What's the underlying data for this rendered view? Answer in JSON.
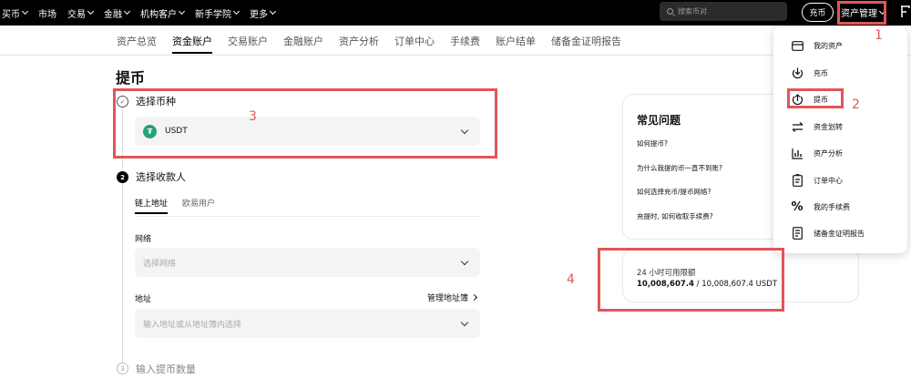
{
  "topnav": {
    "items": [
      {
        "label": "买币",
        "chevron": true
      },
      {
        "label": "市场",
        "chevron": false
      },
      {
        "label": "交易",
        "chevron": true
      },
      {
        "label": "金融",
        "chevron": true
      },
      {
        "label": "机构客户",
        "chevron": true
      },
      {
        "label": "新手学院",
        "chevron": true
      },
      {
        "label": "更多",
        "chevron": true
      }
    ],
    "search_placeholder": "搜索币对",
    "deposit_label": "充币",
    "asset_label": "资产管理"
  },
  "subnav": {
    "tabs": [
      "资产总览",
      "资金账户",
      "交易账户",
      "金融账户",
      "资产分析",
      "订单中心",
      "手续费",
      "账户结单",
      "储备金证明报告"
    ],
    "active_index": 1
  },
  "page": {
    "title": "提币",
    "steps": [
      {
        "num": "✓",
        "label": "选择币种",
        "state": "done"
      },
      {
        "num": "2",
        "label": "选择收款人",
        "state": "active"
      },
      {
        "num": "3",
        "label": "输入提币数量",
        "state": "todo"
      }
    ],
    "coin": {
      "logo_glyph": "₮",
      "value": "USDT"
    },
    "recipient_tabs": [
      "链上地址",
      "欧易用户"
    ],
    "network": {
      "label": "网络",
      "placeholder": "选择网络"
    },
    "address": {
      "label": "地址",
      "book_label": "管理地址簿",
      "placeholder": "输入地址或从地址簿内选择"
    }
  },
  "faq": {
    "title": "常见问题",
    "questions": [
      "如何提币?",
      "为什么我提的币一直不到账?",
      "如何选择充币/提币网络?",
      "充提时, 如何收取手续费?"
    ]
  },
  "limit": {
    "label": "24 小时可用限额",
    "used": "10,008,607.4",
    "rest": " / 10,008,607.4 USDT"
  },
  "dropdown": {
    "items": [
      {
        "label": "我的资产",
        "icon": "wallet-icon"
      },
      {
        "label": "充币",
        "icon": "deposit-icon"
      },
      {
        "label": "提币",
        "icon": "withdraw-icon"
      },
      {
        "label": "资金划转",
        "icon": "transfer-icon"
      },
      {
        "label": "资产分析",
        "icon": "chart-icon"
      },
      {
        "label": "订单中心",
        "icon": "clipboard-icon"
      },
      {
        "label": "我的手续费",
        "icon": "percent-icon"
      },
      {
        "label": "储备金证明报告",
        "icon": "report-icon"
      }
    ]
  },
  "annotations": {
    "numbers": [
      "1",
      "2",
      "3",
      "4"
    ],
    "color": "#e0565a"
  }
}
